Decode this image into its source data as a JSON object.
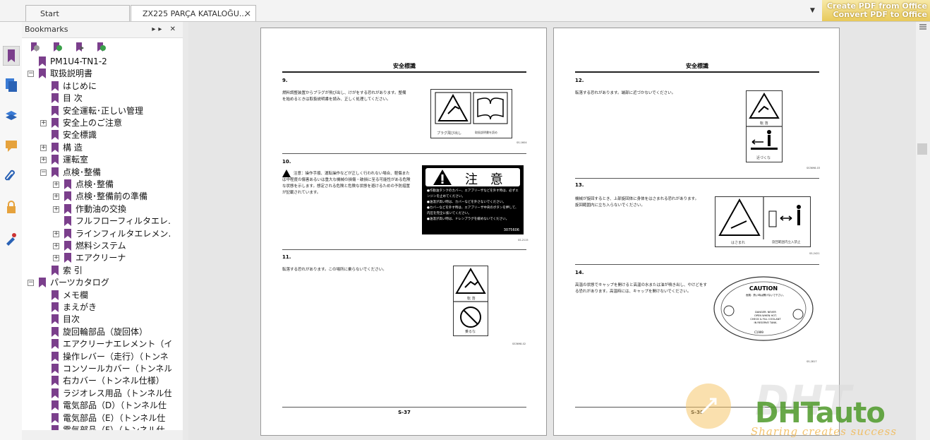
{
  "tabs": {
    "start": "Start",
    "document": "ZX225 PARÇA KATALOĞU...",
    "close": "×",
    "dropdown": "▼"
  },
  "promo": {
    "line1": "Create PDF from Office",
    "line2": "Convert PDF to Office"
  },
  "bookmarks": {
    "title": "Bookmarks",
    "controls": "▸▸ ✕",
    "items": [
      {
        "label": "PM1U4-TN1-2",
        "level": 0,
        "expander": ""
      },
      {
        "label": "取扱説明書",
        "level": 0,
        "expander": "−"
      },
      {
        "label": "はじめに",
        "level": 1,
        "expander": ""
      },
      {
        "label": "目 次",
        "level": 1,
        "expander": ""
      },
      {
        "label": "安全運転･正しい管理",
        "level": 1,
        "expander": ""
      },
      {
        "label": "安全上のご注意",
        "level": 1,
        "expander": "+"
      },
      {
        "label": "安全標識",
        "level": 1,
        "expander": ""
      },
      {
        "label": "構 造",
        "level": 1,
        "expander": "+"
      },
      {
        "label": "運転室",
        "level": 1,
        "expander": "+"
      },
      {
        "label": "点検･整備",
        "level": 1,
        "expander": "−"
      },
      {
        "label": "点検･整備",
        "level": 2,
        "expander": "+"
      },
      {
        "label": "点検･整備前の準備",
        "level": 2,
        "expander": "+"
      },
      {
        "label": "作動油の交換",
        "level": 2,
        "expander": "+"
      },
      {
        "label": "フルフローフィルタエレ…",
        "level": 2,
        "expander": ""
      },
      {
        "label": "ラインフィルタエレメン…",
        "level": 2,
        "expander": "+"
      },
      {
        "label": "燃料システム",
        "level": 2,
        "expander": "+"
      },
      {
        "label": "エアクリーナ",
        "level": 2,
        "expander": "+"
      },
      {
        "label": "索 引",
        "level": 1,
        "expander": ""
      },
      {
        "label": "パーツカタログ",
        "level": 0,
        "expander": "−"
      },
      {
        "label": "メモ欄",
        "level": 1,
        "expander": ""
      },
      {
        "label": "まえがき",
        "level": 1,
        "expander": ""
      },
      {
        "label": "目次",
        "level": 1,
        "expander": ""
      },
      {
        "label": "旋回輪部品（旋回体）",
        "level": 1,
        "expander": ""
      },
      {
        "label": "エアクリーナエレメント（イ",
        "level": 1,
        "expander": ""
      },
      {
        "label": "操作レバー（走行）（トンネ",
        "level": 1,
        "expander": ""
      },
      {
        "label": "コンソールカバー（トンネル",
        "level": 1,
        "expander": ""
      },
      {
        "label": "右カバー（トンネル仕様）",
        "level": 1,
        "expander": ""
      },
      {
        "label": "ラジオレス用品（トンネル仕",
        "level": 1,
        "expander": ""
      },
      {
        "label": "電気部品（D）（トンネル仕",
        "level": 1,
        "expander": ""
      },
      {
        "label": "電気部品（E）（トンネル仕",
        "level": 1,
        "expander": ""
      },
      {
        "label": "電気部品（F）（トンネル仕",
        "level": 1,
        "expander": ""
      }
    ]
  },
  "page_left": {
    "title": "安全標識",
    "footer": "S-37",
    "sections": [
      {
        "num": "9.",
        "text": "燃料調整装置からプラグが飛び出し、けがをする恐れがあります。整備を始めるときは取扱説明書を読み、正しく処理してください。",
        "label1": "プラグ飛び出し",
        "label2": "取扱説明書を読め",
        "code": "SS-1604"
      },
      {
        "num": "10.",
        "text": "注意：操作手順、運転操作などが正しく行われない場合、軽傷または中程度の傷害あるいは重大な機械の損傷・破損に至る可能性がある危険な状態を示します。想定される危険と危険な状態を避けるための予防措置が記載されています。",
        "warn_title": "注 意",
        "warn_lines": [
          "●作動油タンクのカバー、エアブリーザなどを外す時は、必ずエンジンを止めてください。",
          "●油温が高い時は、カバーなどを外さないでください。",
          "●カバーなどを外す時は、エアブリーザ中央のボタンを押して、内圧を完全に抜いてください。",
          "●油温が高い時は、ドレンプラグを緩めないでください。"
        ],
        "warn_code": "3075606",
        "code": "SS-2115"
      },
      {
        "num": "11.",
        "text": "転落する恐れがあります。この場所に乗らないでください。",
        "label1": "転 落",
        "label2": "乗るな",
        "code": "SS3698-02"
      }
    ]
  },
  "page_right": {
    "title": "安全標識",
    "footer": "S-38",
    "sections": [
      {
        "num": "12.",
        "text": "転落する恐れがあります。端部に近づかないでください。",
        "label1": "転 落",
        "label2": "近づくな",
        "code": "SS3698-03"
      },
      {
        "num": "13.",
        "text": "機械が旋回するとき、上部旋回体に身体をはさまれる恐れがあります。旋回範囲内に立ち入らないでください。",
        "label1": "はさまれ",
        "label2": "旋回範囲内立入禁止",
        "code": "SS-2421"
      },
      {
        "num": "14.",
        "text": "高温の状態でキャップを開けると高温の水または油が噴き出し、やけどをする恐れがあります。高温時には、キャップを開けないでください。",
        "cap_title": "CAUTION",
        "cap_lines": [
          "DANGER: NEVER",
          "OPEN WHEN HOT.",
          "CHECK & FILL COOLANT",
          "IN RESERVE TANK."
        ],
        "cap_top": "危険：熱い時は開けないで下さい。",
        "cap_code": "C1999",
        "code": "SS-2817"
      }
    ]
  },
  "watermark": {
    "brand": "DHTauto",
    "slogan": "Sharing creates success"
  },
  "colors": {
    "bookmark_flag": "#7b3f8c",
    "promo": "#e8c95a",
    "watermark": "#4e9a2a"
  }
}
